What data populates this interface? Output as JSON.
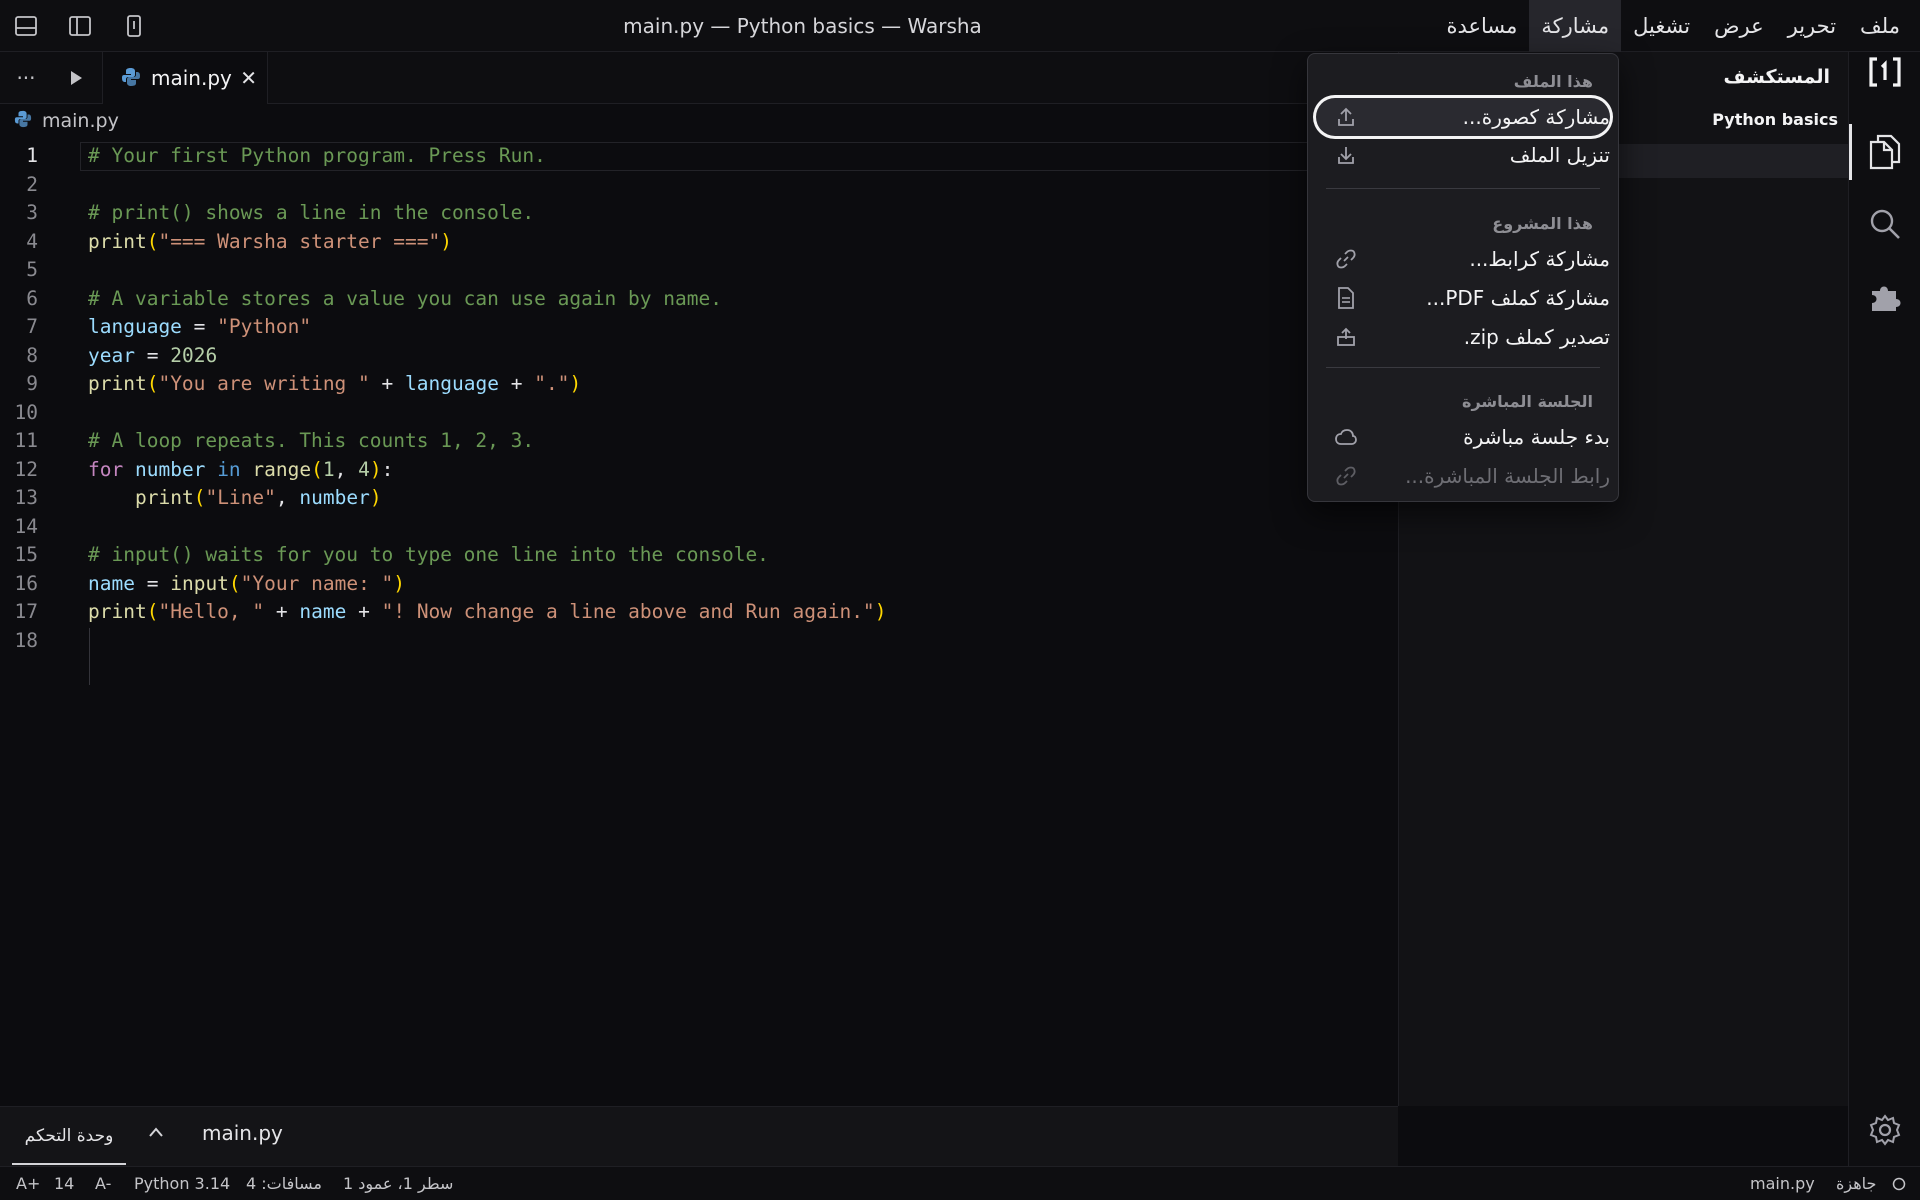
{
  "window": {
    "title": "main.py — Python basics — Warsha"
  },
  "menubar": {
    "items": [
      {
        "label": "ملف"
      },
      {
        "label": "تحرير"
      },
      {
        "label": "عرض"
      },
      {
        "label": "تشغيل"
      },
      {
        "label": "مشاركة",
        "active": true
      },
      {
        "label": "مساعدة"
      }
    ]
  },
  "titlebar_icons": [
    "panel-bottom-icon",
    "sidebar-toggle-icon",
    "device-icon"
  ],
  "sidebar": {
    "title": "المستكشف",
    "project": "Python basics"
  },
  "activitybar": {
    "icons": [
      "logo-icon",
      "files-icon",
      "search-icon",
      "extensions-icon",
      "settings-icon"
    ]
  },
  "tabs": {
    "more": "···",
    "active": {
      "label": "main.py",
      "icon": "python-icon"
    },
    "close": "✕"
  },
  "breadcrumb": {
    "file": "main.py"
  },
  "editor": {
    "current_line": 1,
    "line_numbers": [
      "1",
      "2",
      "3",
      "4",
      "5",
      "6",
      "7",
      "8",
      "9",
      "10",
      "11",
      "12",
      "13",
      "14",
      "15",
      "16",
      "17",
      "18"
    ],
    "lines": [
      "# Your first Python program. Press Run.",
      "",
      "# print() shows a line in the console.",
      "print(\"=== Warsha starter ===\")",
      "",
      "# A variable stores a value you can use again by name.",
      "language = \"Python\"",
      "year = 2026",
      "print(\"You are writing \" + language + \".\")",
      "",
      "# A loop repeats. This counts 1, 2, 3.",
      "for number in range(1, 4):",
      "    print(\"Line\", number)",
      "",
      "# input() waits for you to type one line into the console.",
      "name = input(\"Your name: \")",
      "print(\"Hello, \" + name + \"! Now change a line above and Run again.\")",
      ""
    ]
  },
  "panel": {
    "tab_label": "وحدة التحكم",
    "chevron": "^",
    "file": "main.py"
  },
  "statusbar": {
    "font_increase": "A+",
    "font_size": "14",
    "font_decrease": "A-",
    "language": "Python 3.14",
    "spaces": "مسافات: 4",
    "position": "سطر 1، عمود 1",
    "file": "main.py",
    "status": "جاهزة"
  },
  "share_menu": {
    "sections": [
      {
        "header": "هذا الملف",
        "items": [
          {
            "label": "مشاركة كصورة...",
            "icon": "upload-icon",
            "highlighted": true
          },
          {
            "label": "تنزيل الملف",
            "icon": "download-icon"
          }
        ]
      },
      {
        "header": "هذا المشروع",
        "items": [
          {
            "label": "مشاركة كرابط...",
            "icon": "link-icon"
          },
          {
            "label": "مشاركة كملف PDF...",
            "icon": "document-icon"
          },
          {
            "label": "تصدير كملف zip.",
            "icon": "export-icon"
          }
        ]
      },
      {
        "header": "الجلسة المباشرة",
        "items": [
          {
            "label": "بدء جلسة مباشرة",
            "icon": "cloud-icon"
          },
          {
            "label": "رابط الجلسة المباشرة...",
            "icon": "link-icon",
            "disabled": true
          }
        ]
      }
    ]
  }
}
